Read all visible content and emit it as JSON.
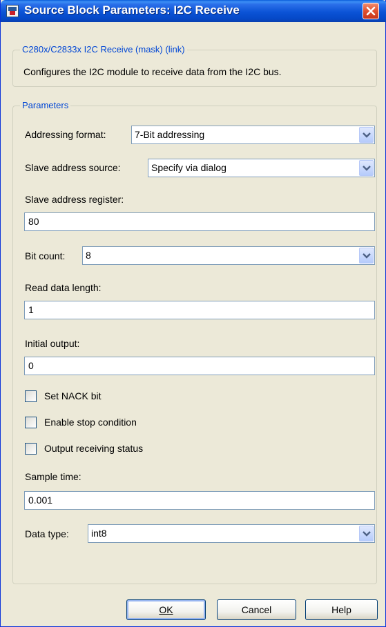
{
  "window": {
    "title": "Source Block Parameters: I2C Receive"
  },
  "mask": {
    "legend": "C280x/C2833x I2C Receive (mask) (link)",
    "description": "Configures the I2C module to receive data from the I2C bus."
  },
  "params": {
    "legend": "Parameters",
    "addressing_format": {
      "label": "Addressing format:",
      "value": "7-Bit addressing"
    },
    "slave_address_source": {
      "label": "Slave address source:",
      "value": "Specify via dialog"
    },
    "slave_address_register": {
      "label": "Slave address register:",
      "value": "80"
    },
    "bit_count": {
      "label": "Bit count:",
      "value": "8"
    },
    "read_data_length": {
      "label": "Read data length:",
      "value": "1"
    },
    "initial_output": {
      "label": "Initial output:",
      "value": "0"
    },
    "set_nack_bit": {
      "label": "Set NACK bit",
      "checked": false
    },
    "enable_stop_condition": {
      "label": "Enable stop condition",
      "checked": false
    },
    "output_receiving_status": {
      "label": "Output receiving status",
      "checked": false
    },
    "sample_time": {
      "label": "Sample time:",
      "value": "0.001"
    },
    "data_type": {
      "label": "Data type:",
      "value": "int8"
    }
  },
  "buttons": {
    "ok": "OK",
    "cancel": "Cancel",
    "help": "Help"
  },
  "icons": {
    "app": "simulink-block-icon",
    "close": "close-icon",
    "dropdown": "chevron-down-icon"
  },
  "colors": {
    "titlebar": "#0b53d6",
    "close": "#e0502f",
    "legend": "#0046d5",
    "dialog_bg": "#ece9d8"
  }
}
